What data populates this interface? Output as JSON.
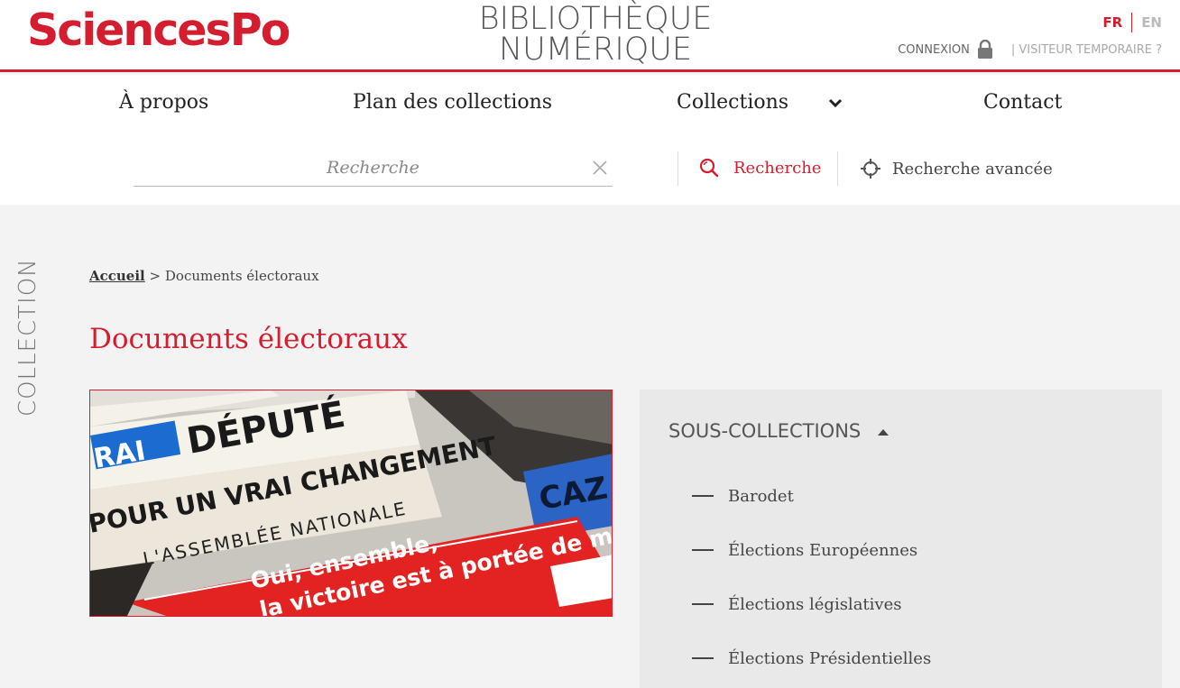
{
  "header": {
    "logo": "SciencesPo",
    "title_line1": "BIBLIOTHÈQUE",
    "title_line2": "NUMÉRIQUE",
    "lang_fr": "FR",
    "lang_en": "EN",
    "login": "CONNEXION",
    "visitor": "| VISITEUR TEMPORAIRE ?",
    "accent_color": "#d41e2f"
  },
  "nav": {
    "items": [
      "À propos",
      "Plan des collections",
      "Collections",
      "Contact"
    ]
  },
  "search": {
    "placeholder": "Recherche",
    "value": "",
    "button_label": "Recherche",
    "advanced_label": "Recherche avancée"
  },
  "side_label": "COLLECTION",
  "breadcrumb": {
    "home": "Accueil",
    "separator": ">",
    "current": "Documents électoraux"
  },
  "page_title": "Documents électoraux",
  "hero_image": {
    "text_lines": [
      "RAI",
      "DÉPUTÉ",
      "POUR UN VRAI CHANGEMENT",
      "L'ASSEMBLÉE NATIONALE",
      "Oui, ensemble,",
      "la victoire est à portée de main",
      "CAZ"
    ]
  },
  "subcollections": {
    "title": "SOUS-COLLECTIONS",
    "items": [
      "Barodet",
      "Élections Européennes",
      "Élections législatives",
      "Élections Présidentielles"
    ]
  }
}
